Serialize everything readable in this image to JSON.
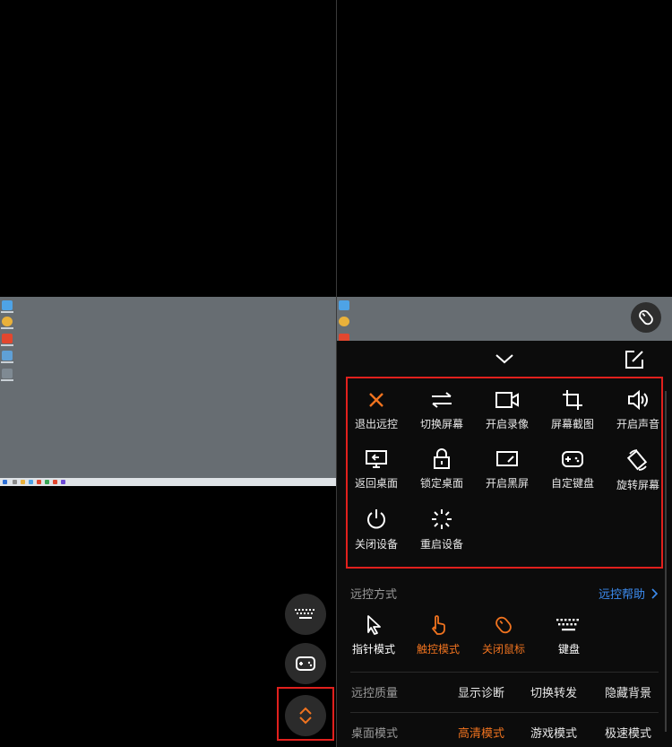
{
  "colors": {
    "accent": "#f0731f",
    "link": "#3c8cf0",
    "highlight_box": "#e1201d"
  },
  "left_panel": {
    "floating_buttons": [
      {
        "name": "keyboard-fab",
        "icon": "keyboard-icon"
      },
      {
        "name": "gamepad-fab",
        "icon": "gamepad-icon"
      },
      {
        "name": "expand-toolbar-fab",
        "icon": "chevron-up-down-icon"
      }
    ]
  },
  "toolbar_grid": [
    {
      "label": "退出远控",
      "icon": "close-icon",
      "accent": true
    },
    {
      "label": "切换屏幕",
      "icon": "switch-arrows-icon"
    },
    {
      "label": "开启录像",
      "icon": "video-camera-icon"
    },
    {
      "label": "屏幕截图",
      "icon": "crop-icon"
    },
    {
      "label": "开启声音",
      "icon": "speaker-icon"
    },
    {
      "label": "返回桌面",
      "icon": "desktop-return-icon"
    },
    {
      "label": "锁定桌面",
      "icon": "lock-icon"
    },
    {
      "label": "开启黑屏",
      "icon": "black-screen-icon"
    },
    {
      "label": "自定键盘",
      "icon": "gamepad-icon"
    },
    {
      "label": "旋转屏幕",
      "icon": "rotate-screen-icon"
    },
    {
      "label": "关闭设备",
      "icon": "power-icon"
    },
    {
      "label": "重启设备",
      "icon": "restart-spinner-icon"
    }
  ],
  "control_mode": {
    "title": "远控方式",
    "help_link": "远控帮助",
    "modes": [
      {
        "label": "指针模式",
        "icon": "pointer-icon",
        "active": false
      },
      {
        "label": "触控模式",
        "icon": "touch-hand-icon",
        "active": true
      },
      {
        "label": "关闭鼠标",
        "icon": "mouse-icon",
        "active": true
      },
      {
        "label": "键盘",
        "icon": "keyboard-icon",
        "active": false
      }
    ]
  },
  "quality": {
    "label": "远控质量",
    "options": [
      "显示诊断",
      "切换转发",
      "隐藏背景"
    ]
  },
  "desktop_mode": {
    "label": "桌面模式",
    "options": [
      {
        "label": "高清模式",
        "active": true
      },
      {
        "label": "游戏模式",
        "active": false
      },
      {
        "label": "极速模式",
        "active": false
      }
    ]
  }
}
